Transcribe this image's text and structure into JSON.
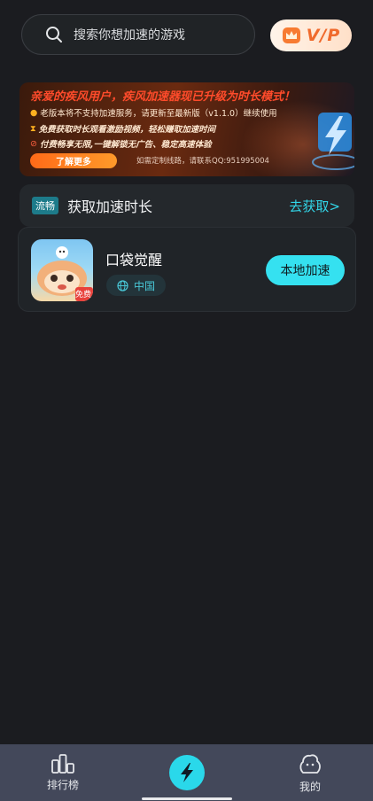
{
  "search": {
    "placeholder": "搜索你想加速的游戏",
    "icon": "search-icon"
  },
  "vip": {
    "label": "V/P",
    "icon": "crown-icon",
    "color": "#f06a2c"
  },
  "banner": {
    "title": "亲爱的疾风用户，疾风加速器现已升级为时长模式！",
    "line1": "老版本将不支持加速服务，请更新至最新版（v1.1.0）继续使用",
    "line2": "免费获取时长观看激励视频，轻松赚取加速时间",
    "line3": "付费畅享无限,一键解锁无广告、稳定高速体验",
    "more_label": "了解更多",
    "contact": "如需定制线路，请联系QQ:951995004"
  },
  "duration": {
    "tag": "流畅",
    "label": "获取加速时长",
    "link": "去获取>"
  },
  "game": {
    "name": "口袋觉醒",
    "region": "中国",
    "badge": "免费",
    "action_label": "本地加速",
    "accent": "#35e1f0"
  },
  "nav": {
    "items": [
      {
        "label": "排行榜",
        "icon": "bar-chart-icon"
      },
      {
        "label": "",
        "icon": "lightning-icon"
      },
      {
        "label": "我的",
        "icon": "user-icon"
      }
    ]
  }
}
